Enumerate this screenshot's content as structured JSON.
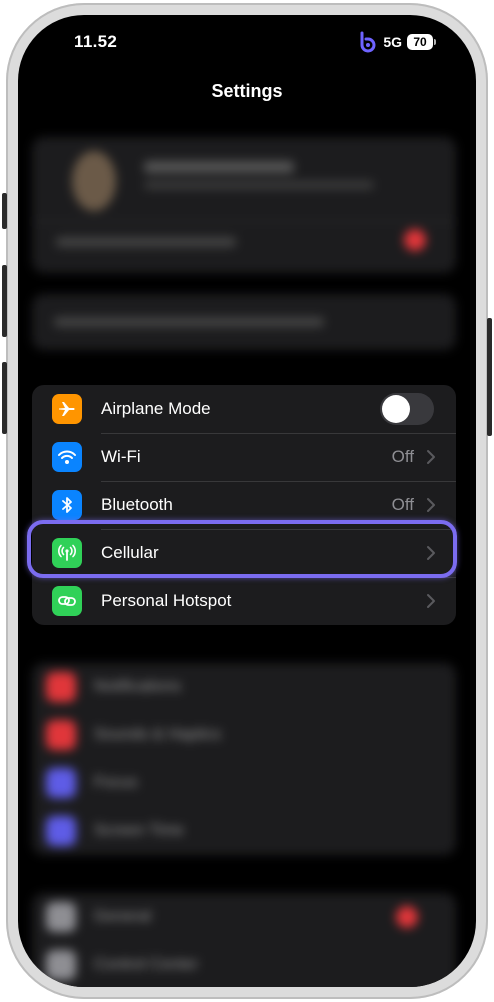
{
  "status_bar": {
    "time": "11.52",
    "network": "5G",
    "battery": "70"
  },
  "header": {
    "title": "Settings"
  },
  "settings_group": {
    "items": [
      {
        "label": "Airplane Mode",
        "icon": "airplane-icon",
        "icon_color": "#ff9500",
        "control": "toggle",
        "toggle_on": false
      },
      {
        "label": "Wi-Fi",
        "icon": "wifi-icon",
        "icon_color": "#0a84ff",
        "value": "Off"
      },
      {
        "label": "Bluetooth",
        "icon": "bluetooth-icon",
        "icon_color": "#0a84ff",
        "value": "Off"
      },
      {
        "label": "Cellular",
        "icon": "cellular-antenna-icon",
        "icon_color": "#30d158",
        "value": ""
      },
      {
        "label": "Personal Hotspot",
        "icon": "hotspot-link-icon",
        "icon_color": "#30d158",
        "value": ""
      }
    ]
  },
  "highlight": {
    "target": "Cellular",
    "color": "#7b6cf0"
  },
  "colors": {
    "screen_bg": "#000000",
    "group_bg": "#1c1c1e",
    "secondary_text": "#8e8e93"
  }
}
